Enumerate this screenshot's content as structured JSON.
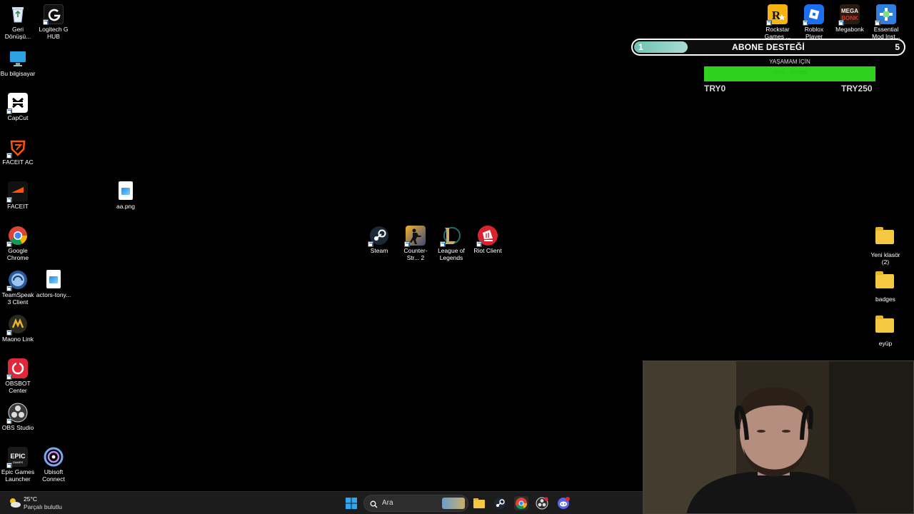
{
  "desktop": {
    "left_icons": [
      {
        "id": "recycle",
        "label": "Geri Dönüşü...",
        "icon": "recycle-bin-icon",
        "color": "#dfe8f5"
      },
      {
        "id": "logitech",
        "label": "Logitech G HUB",
        "icon": "logitech-g-icon",
        "color": "#111111"
      },
      {
        "id": "computer",
        "label": "Bu bilgisayar",
        "icon": "monitor-icon",
        "color": "#2aa3e0"
      },
      {
        "id": "capcut",
        "label": "CapCut",
        "icon": "capcut-icon",
        "color": "#ffffff"
      },
      {
        "id": "faceitac",
        "label": "FACEIT AC",
        "icon": "faceit-ac-icon",
        "color": "#ff5500"
      },
      {
        "id": "faceit",
        "label": "FACEIT",
        "icon": "faceit-icon",
        "color": "#ff5500"
      },
      {
        "id": "aapng",
        "label": "aa.png",
        "icon": "image-file-icon",
        "color": "#ffffff"
      },
      {
        "id": "chrome",
        "label": "Google Chrome",
        "icon": "chrome-icon",
        "color": "#34a853"
      },
      {
        "id": "teamspeak",
        "label": "TeamSpeak 3 Client",
        "icon": "teamspeak-icon",
        "color": "#3b6fb5"
      },
      {
        "id": "actors",
        "label": "actors-tony...",
        "icon": "image-file-icon",
        "color": "#ffffff"
      },
      {
        "id": "maono",
        "label": "Maono Link",
        "icon": "maono-icon",
        "color": "#3a3a2a"
      },
      {
        "id": "obsbot",
        "label": "OBSBOT Center",
        "icon": "obsbot-icon",
        "color": "#e0283a"
      },
      {
        "id": "obs",
        "label": "OBS Studio",
        "icon": "obs-icon",
        "color": "#3a3a3a"
      },
      {
        "id": "epic",
        "label": "Epic Games Launcher",
        "icon": "epic-games-icon",
        "color": "#202020"
      },
      {
        "id": "ubisoft",
        "label": "Ubisoft Connect",
        "icon": "ubisoft-icon",
        "color": "#5a8fe0"
      }
    ],
    "center_icons": [
      {
        "id": "steam",
        "label": "Steam",
        "icon": "steam-icon",
        "color": "#1b3a5c"
      },
      {
        "id": "cs2",
        "label": "Counter-Str... 2",
        "icon": "counter-strike-icon",
        "color": "#e0a020"
      },
      {
        "id": "lol",
        "label": "League of Legends",
        "icon": "league-of-legends-icon",
        "color": "#1c3e3a"
      },
      {
        "id": "riot",
        "label": "Riot Client",
        "icon": "riot-client-icon",
        "color": "#d9232f"
      }
    ],
    "top_right_icons": [
      {
        "id": "rockstar",
        "label": "Rockstar Games ...",
        "icon": "rockstar-icon",
        "color": "#f6b40e"
      },
      {
        "id": "roblox",
        "label": "Roblox Player",
        "icon": "roblox-icon",
        "color": "#1d6ff2"
      },
      {
        "id": "megabonk",
        "label": "Megabonk",
        "icon": "megabonk-icon",
        "color": "#c2261e"
      },
      {
        "id": "essential",
        "label": "Essential Mod Inst...",
        "icon": "essential-mod-icon",
        "color": "#2f7fe0"
      }
    ],
    "right_folders": [
      {
        "id": "yeniklasor",
        "label": "Yeni klasör (2)",
        "icon": "folder-icon"
      },
      {
        "id": "badges",
        "label": "badges",
        "icon": "folder-icon"
      },
      {
        "id": "eyup",
        "label": "eyüp",
        "icon": "folder-icon"
      }
    ]
  },
  "sub_widget": {
    "title": "ABONE DESTEĞİ",
    "current": "1",
    "target": "5",
    "progress": 0.2
  },
  "donation_goal": {
    "title": "YAŞAMAM İÇİN",
    "bar_text": "TRY0 / TRY250",
    "min": "TRY0",
    "max": "TRY250",
    "progress": 1.0,
    "bar_color": "#2ed11e"
  },
  "taskbar": {
    "weather_temp": "25°C",
    "weather_desc": "Parçalı bulutlu",
    "search_placeholder": "Ara",
    "apps": [
      "windows-start-icon",
      "file-explorer-icon",
      "steam-icon",
      "chrome-icon",
      "obs-icon",
      "discord-icon"
    ]
  }
}
